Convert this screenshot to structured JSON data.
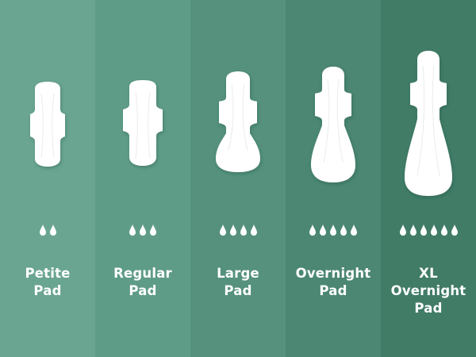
{
  "colors": {
    "panel_1": "#6aa592",
    "panel_2": "#5f9c88",
    "panel_3": "#55917d",
    "panel_4": "#4b8772",
    "panel_5": "#417c67",
    "pad": "#ffffff",
    "text": "#ffffff"
  },
  "products": [
    {
      "name_lines": [
        "Petite",
        "Pad"
      ],
      "absorbency_drops": 2,
      "icon": "petite-pad-icon"
    },
    {
      "name_lines": [
        "Regular",
        "Pad"
      ],
      "absorbency_drops": 3,
      "icon": "regular-pad-icon"
    },
    {
      "name_lines": [
        "Large",
        "Pad"
      ],
      "absorbency_drops": 4,
      "icon": "large-pad-icon"
    },
    {
      "name_lines": [
        "Overnight",
        "Pad"
      ],
      "absorbency_drops": 5,
      "icon": "overnight-pad-icon"
    },
    {
      "name_lines": [
        "XL",
        "Overnight",
        "Pad"
      ],
      "absorbency_drops": 6,
      "icon": "xl-overnight-pad-icon"
    }
  ]
}
